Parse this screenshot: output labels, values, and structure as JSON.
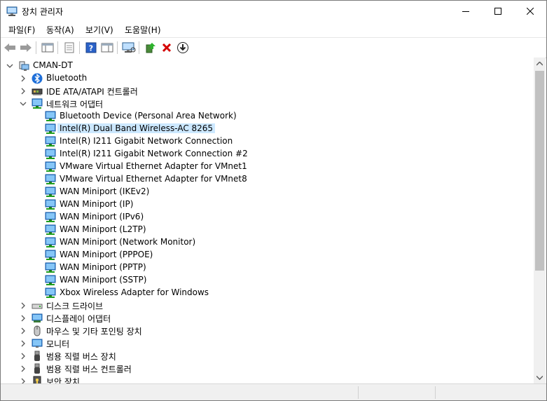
{
  "window": {
    "title": "장치 관리자"
  },
  "menu": [
    "파일(F)",
    "동작(A)",
    "보기(V)",
    "도움말(H)"
  ],
  "tree": {
    "root": "CMAN-DT",
    "categories": [
      {
        "label": "Bluetooth",
        "icon": "bluetooth-icon"
      },
      {
        "label": "IDE ATA/ATAPI 컨트롤러",
        "icon": "ide-controller-icon"
      },
      {
        "label": "네트워크 어댑터",
        "icon": "network-adapter-icon",
        "expanded": true,
        "children": [
          "Bluetooth Device (Personal Area Network)",
          "Intel(R) Dual Band Wireless-AC 8265",
          "Intel(R) I211 Gigabit Network Connection",
          "Intel(R) I211 Gigabit Network Connection #2",
          "VMware Virtual Ethernet Adapter for VMnet1",
          "VMware Virtual Ethernet Adapter for VMnet8",
          "WAN Miniport (IKEv2)",
          "WAN Miniport (IP)",
          "WAN Miniport (IPv6)",
          "WAN Miniport (L2TP)",
          "WAN Miniport (Network Monitor)",
          "WAN Miniport (PPPOE)",
          "WAN Miniport (PPTP)",
          "WAN Miniport (SSTP)",
          "Xbox Wireless Adapter for Windows"
        ],
        "selected": "Intel(R) Dual Band Wireless-AC 8265"
      },
      {
        "label": "디스크 드라이브",
        "icon": "disk-drive-icon"
      },
      {
        "label": "디스플레이 어댑터",
        "icon": "display-adapter-icon"
      },
      {
        "label": "마우스 및 기타 포인팅 장치",
        "icon": "mouse-icon"
      },
      {
        "label": "모니터",
        "icon": "monitor-icon"
      },
      {
        "label": "범용 직렬 버스 장치",
        "icon": "usb-device-icon"
      },
      {
        "label": "범용 직렬 버스 컨트롤러",
        "icon": "usb-controller-icon"
      },
      {
        "label": "보안 장치",
        "icon": "security-device-icon"
      }
    ]
  },
  "colors": {
    "selection": "#cce8ff",
    "accent": "#0078d7",
    "remove": "#d40000"
  }
}
